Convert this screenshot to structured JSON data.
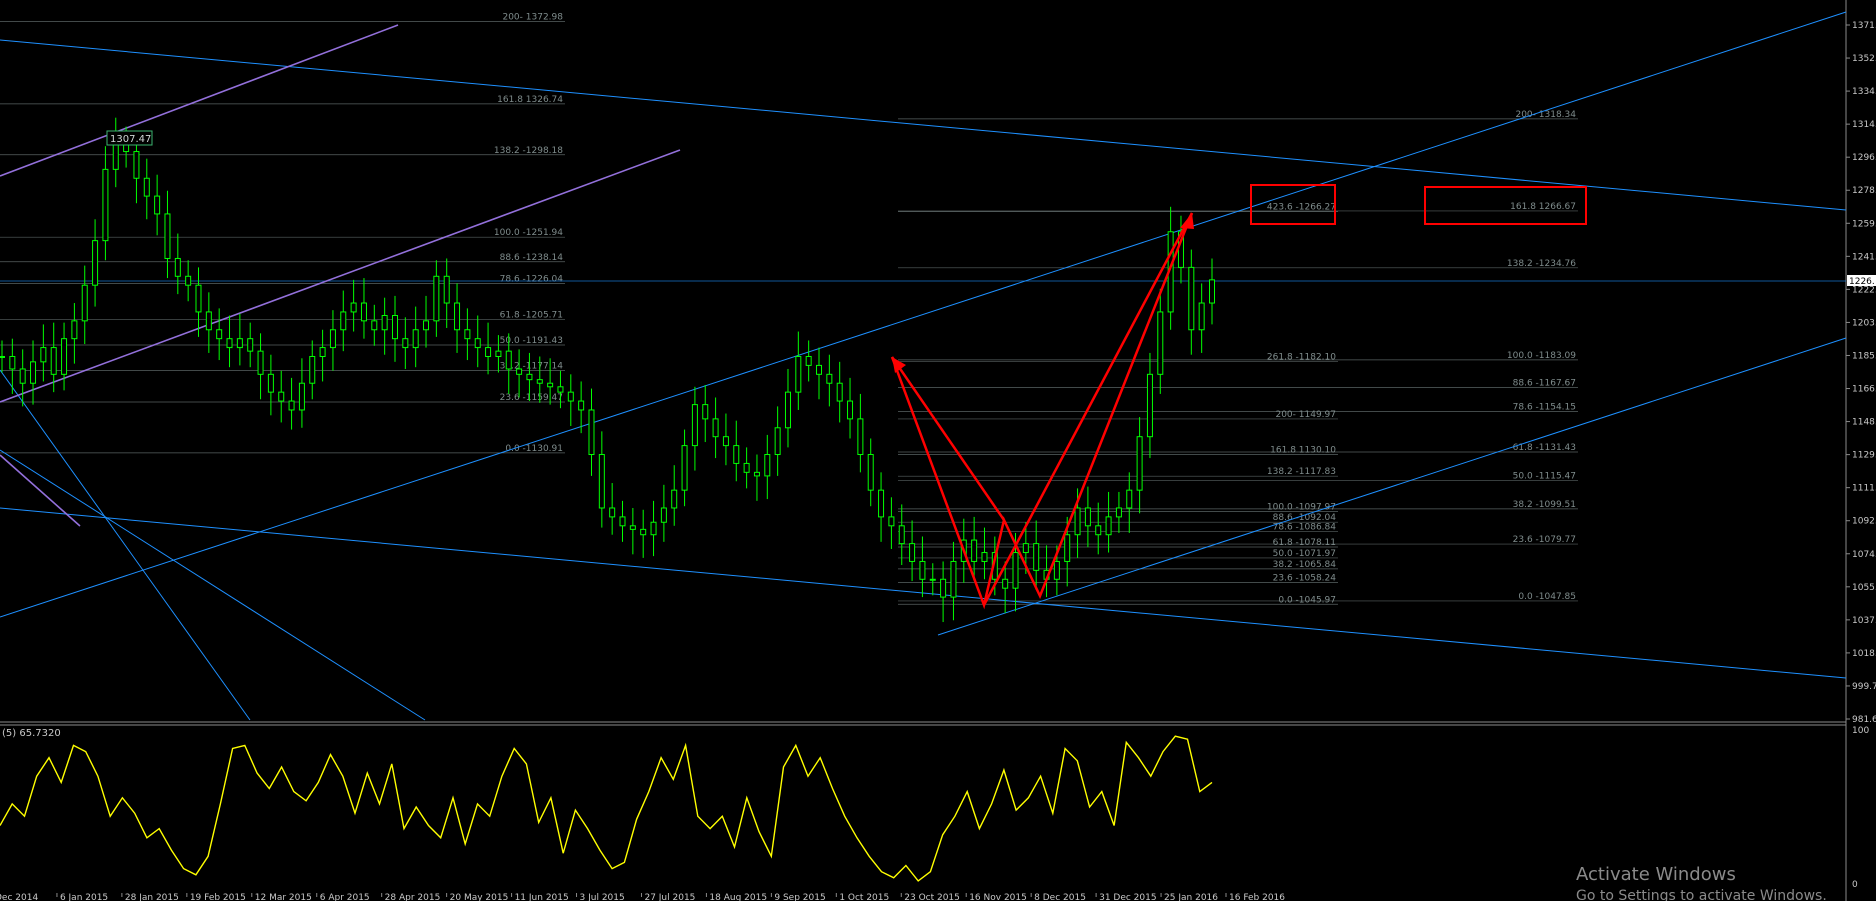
{
  "header": {
    "indicator_label": "(5) 65.7320"
  },
  "watermark": {
    "line1": "Activate Windows",
    "line2": "Go to Settings to activate Windows."
  },
  "colors": {
    "background": "#000000",
    "candles": "#00ff00",
    "trendlines": "#1e90ff",
    "channel": "#9370db",
    "pattern": "#ff0000",
    "oscillator": "#ffff00",
    "fib": "#7f8c8c"
  },
  "chart_data": [
    {
      "type": "candlestick",
      "title": "",
      "y_ticks": [
        "1371.",
        "1352.",
        "1334.",
        "1314.",
        "1296.",
        "1278.",
        "1259.",
        "1241.",
        "1222.",
        "1203.",
        "1185.",
        "1166.",
        "1148.",
        "1129.",
        "1111.",
        "1092.",
        "1074.",
        "1055.",
        "1037.",
        "1018.",
        "999.7",
        "981.6"
      ],
      "ylim": [
        981.6,
        1371
      ],
      "current_price_label": "1226.",
      "x_ticks": [
        "Dec 2014",
        "6 Jan 2015",
        "28 Jan 2015",
        "19 Feb 2015",
        "12 Mar 2015",
        "6 Apr 2015",
        "28 Apr 2015",
        "20 May 2015",
        "11 Jun 2015",
        "3 Jul 2015",
        "27 Jul 2015",
        "18 Aug 2015",
        "9 Sep 2015",
        "1 Oct 2015",
        "23 Oct 2015",
        "16 Nov 2015",
        "8 Dec 2015",
        "31 Dec 2015",
        "25 Jan 2016",
        "16 Feb 2016"
      ],
      "price_label": "1307.47",
      "close_series": [
        1185,
        1178,
        1170,
        1182,
        1190,
        1175,
        1195,
        1205,
        1225,
        1250,
        1290,
        1305,
        1300,
        1285,
        1275,
        1265,
        1240,
        1230,
        1225,
        1210,
        1200,
        1195,
        1190,
        1195,
        1188,
        1175,
        1165,
        1160,
        1155,
        1170,
        1185,
        1190,
        1200,
        1210,
        1215,
        1205,
        1200,
        1208,
        1195,
        1190,
        1200,
        1205,
        1230,
        1215,
        1200,
        1195,
        1190,
        1185,
        1188,
        1178,
        1175,
        1172,
        1170,
        1168,
        1165,
        1160,
        1155,
        1130,
        1100,
        1095,
        1090,
        1088,
        1085,
        1092,
        1100,
        1110,
        1135,
        1158,
        1150,
        1140,
        1135,
        1125,
        1120,
        1118,
        1130,
        1145,
        1165,
        1185,
        1180,
        1175,
        1170,
        1160,
        1150,
        1130,
        1110,
        1095,
        1090,
        1080,
        1070,
        1060,
        1060,
        1050,
        1070,
        1082,
        1070,
        1075,
        1060,
        1055,
        1075,
        1080,
        1065,
        1060,
        1070,
        1085,
        1100,
        1090,
        1085,
        1095,
        1100,
        1110,
        1140,
        1175,
        1210,
        1255,
        1235,
        1200,
        1215,
        1228
      ],
      "fib_levels_left": [
        {
          "label": "200- 1372.98",
          "price": 1372.98
        },
        {
          "label": "161.8 1326.74",
          "price": 1326.74
        },
        {
          "label": "138.2 -1298.18",
          "price": 1298.18
        },
        {
          "label": "100.0 -1251.94",
          "price": 1251.94
        },
        {
          "label": "88.6 -1238.14",
          "price": 1238.14
        },
        {
          "label": "78.6 -1226.04",
          "price": 1226.04
        },
        {
          "label": "61.8 -1205.71",
          "price": 1205.71
        },
        {
          "label": "50.0 -1191.43",
          "price": 1191.43
        },
        {
          "label": "38.2 -1177.14",
          "price": 1177.14
        },
        {
          "label": "23.6 -1159.47",
          "price": 1159.47
        },
        {
          "label": "0.0 -1130.91",
          "price": 1130.91
        }
      ],
      "fib_levels_mid": [
        {
          "label": "423.6 -1266.27",
          "price": 1266.27
        },
        {
          "label": "261.8 -1182.10",
          "price": 1182.1
        },
        {
          "label": "200- 1149.97",
          "price": 1149.97
        },
        {
          "label": "161.8 1130.10",
          "price": 1130.1
        },
        {
          "label": "138.2 -1117.83",
          "price": 1117.83
        },
        {
          "label": "100.0 -1097.97",
          "price": 1097.97
        },
        {
          "label": "88.6 -1092.04",
          "price": 1092.04
        },
        {
          "label": "78.6 -1086.84",
          "price": 1086.84
        },
        {
          "label": "61.8 -1078.11",
          "price": 1078.11
        },
        {
          "label": "50.0 -1071.97",
          "price": 1071.97
        },
        {
          "label": "38.2 -1065.84",
          "price": 1065.84
        },
        {
          "label": "23.6 -1058.24",
          "price": 1058.24
        },
        {
          "label": "0.0 -1045.97",
          "price": 1045.97
        }
      ],
      "fib_levels_right": [
        {
          "label": "200- 1318.34",
          "price": 1318.34
        },
        {
          "label": "161.8 1266.67",
          "price": 1266.67
        },
        {
          "label": "138.2 -1234.76",
          "price": 1234.76
        },
        {
          "label": "100.0 -1183.09",
          "price": 1183.09
        },
        {
          "label": "88.6 -1167.67",
          "price": 1167.67
        },
        {
          "label": "78.6 -1154.15",
          "price": 1154.15
        },
        {
          "label": "61.8 -1131.43",
          "price": 1131.43
        },
        {
          "label": "50.0 -1115.47",
          "price": 1115.47
        },
        {
          "label": "38.2 -1099.51",
          "price": 1099.51
        },
        {
          "label": "23.6 -1079.77",
          "price": 1079.77
        },
        {
          "label": "0.0 -1047.85",
          "price": 1047.85
        }
      ]
    },
    {
      "type": "line",
      "title": "",
      "ylim": [
        0,
        100
      ],
      "y_ticks": [
        "100",
        "0"
      ],
      "values": [
        38,
        52,
        44,
        70,
        82,
        66,
        90,
        86,
        70,
        44,
        56,
        46,
        30,
        36,
        22,
        10,
        6,
        18,
        52,
        88,
        90,
        72,
        62,
        76,
        60,
        54,
        66,
        84,
        70,
        46,
        72,
        52,
        78,
        36,
        50,
        38,
        30,
        56,
        26,
        52,
        44,
        70,
        88,
        78,
        40,
        56,
        20,
        48,
        36,
        22,
        10,
        14,
        42,
        60,
        82,
        68,
        90,
        44,
        36,
        44,
        24,
        56,
        34,
        18,
        76,
        90,
        70,
        82,
        62,
        44,
        30,
        18,
        8,
        4,
        12,
        2,
        8,
        32,
        44,
        60,
        36,
        52,
        74,
        48,
        56,
        70,
        46,
        88,
        80,
        50,
        60,
        38,
        92,
        82,
        70,
        86,
        96,
        94,
        60,
        66
      ]
    }
  ]
}
